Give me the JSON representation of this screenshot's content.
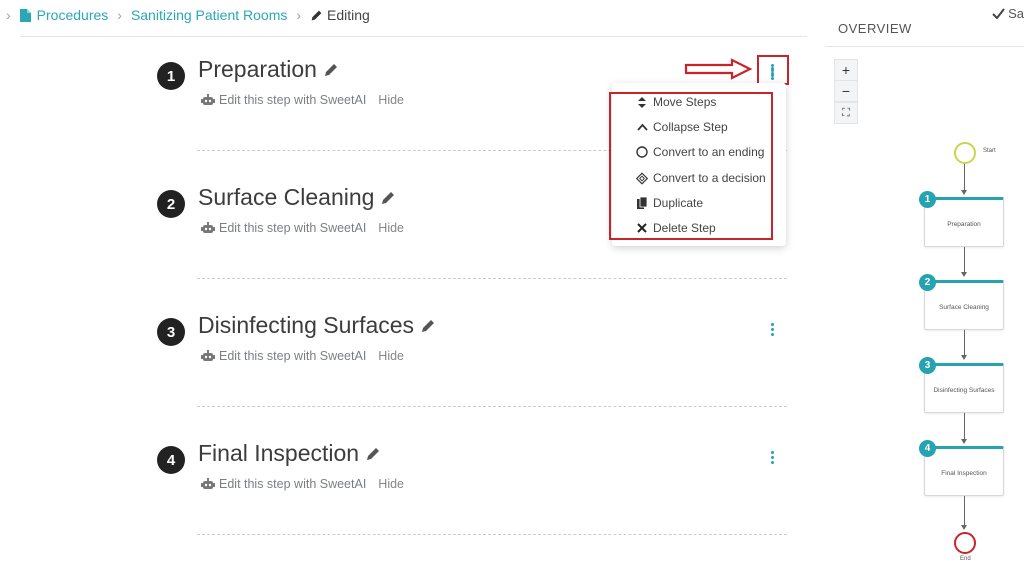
{
  "breadcrumb": {
    "procedures": "Procedures",
    "procedure_name": "Sanitizing Patient Rooms",
    "current": "Editing"
  },
  "header": {
    "save_label": "Sa"
  },
  "steps": [
    {
      "number": "1",
      "title": "Preparation",
      "ai_text": "Edit this step with SweetAI",
      "hide": "Hide"
    },
    {
      "number": "2",
      "title": "Surface Cleaning",
      "ai_text": "Edit this step with SweetAI",
      "hide": "Hide"
    },
    {
      "number": "3",
      "title": "Disinfecting Surfaces",
      "ai_text": "Edit this step with SweetAI",
      "hide": "Hide"
    },
    {
      "number": "4",
      "title": "Final Inspection",
      "ai_text": "Edit this step with SweetAI",
      "hide": "Hide"
    }
  ],
  "menu": {
    "items": [
      {
        "label": "Move Steps",
        "icon": "sort-icon"
      },
      {
        "label": "Collapse Step",
        "icon": "chevron-up-icon"
      },
      {
        "label": "Convert to an ending",
        "icon": "circle-icon"
      },
      {
        "label": "Convert to a decision",
        "icon": "diamond-icon"
      },
      {
        "label": "Duplicate",
        "icon": "copy-icon"
      },
      {
        "label": "Delete Step",
        "icon": "close-icon"
      }
    ]
  },
  "overview": {
    "title": "OVERVIEW",
    "zoom_in": "+",
    "zoom_out": "−",
    "fit": "⛶",
    "start_label": "Start",
    "end_label": "End",
    "nodes": [
      {
        "number": "1",
        "label": "Preparation"
      },
      {
        "number": "2",
        "label": "Surface Cleaning"
      },
      {
        "number": "3",
        "label": "Disinfecting Surfaces"
      },
      {
        "number": "4",
        "label": "Final Inspection"
      }
    ]
  },
  "colors": {
    "accent": "#26a3b1",
    "annotation": "#c9242b",
    "start": "#c8d64a"
  }
}
